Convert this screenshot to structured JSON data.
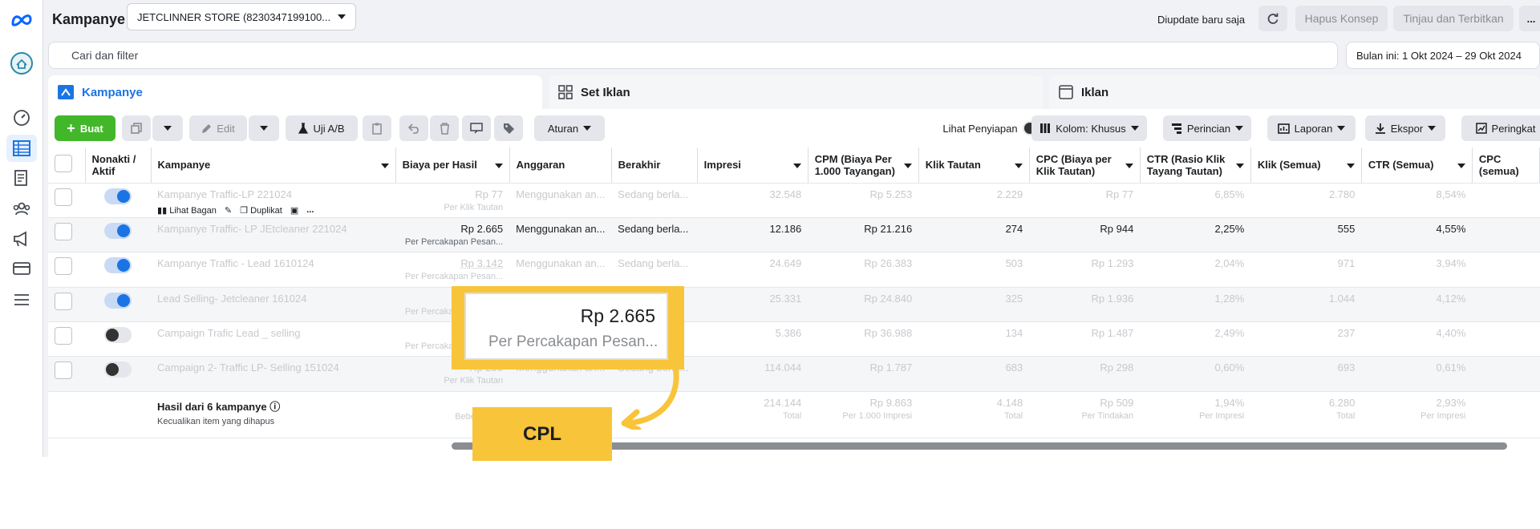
{
  "nav": {
    "items": [
      "meta-logo-icon",
      "business-icon",
      "dashboard-icon",
      "campaigns-icon",
      "pages-icon",
      "audiences-icon",
      "ads-icon",
      "billing-icon",
      "menu-icon"
    ]
  },
  "header": {
    "title": "Kampanye",
    "account": "JETCLINNER STORE (8230347199100...",
    "update_status": "Diupdate baru saja",
    "discard_label": "Hapus Konsep",
    "publish_label": "Tinjau dan Terbitkan",
    "more_label": "..."
  },
  "search": {
    "placeholder": "Cari dan filter"
  },
  "date_range": "Bulan ini: 1 Okt 2024 – 29 Okt 2024",
  "tabs": [
    {
      "label": "Kampanye",
      "icon": "folder-icon"
    },
    {
      "label": "Set Iklan",
      "icon": "grid-icon"
    },
    {
      "label": "Iklan",
      "icon": "ad-frame-icon"
    }
  ],
  "toolbar": {
    "create": "Buat",
    "edit": "Edit",
    "ab_test": "Uji A/B",
    "rules": "Aturan",
    "preview": "Lihat Penyiapan",
    "columns": "Kolom: Khusus",
    "breakdown": "Perincian",
    "reports": "Laporan",
    "export": "Ekspor",
    "summary": "Peringkat"
  },
  "table": {
    "headers": [
      "Nonakti / Aktif",
      "Kampanye",
      "Biaya per Hasil",
      "Anggaran",
      "Berakhir",
      "Impresi",
      "CPM (Biaya Per 1.000 Tayangan)",
      "Klik Tautan",
      "CPC (Biaya per Klik Tautan)",
      "CTR (Rasio Klik Tayang Tautan)",
      "Klik (Semua)",
      "CTR (Semua)",
      "CPC (semua)"
    ],
    "rows": [
      {
        "toggle": true,
        "name": "Kampanye Traffic-LP 221024",
        "cost": "Rp 77",
        "cost_sub": "Per Klik Tautan",
        "budget": "Menggunakan an...",
        "ends": "Sedang berla...",
        "impressions": "32.548",
        "cpm": "Rp 5.253",
        "clicks_link": "2.229",
        "cpc_link": "Rp 77",
        "ctr_link": "6,85%",
        "clicks_all": "2.780",
        "ctr_all": "8,54%"
      },
      {
        "toggle": true,
        "name": "Kampanye Traffic- LP JEtcleaner 221024",
        "cost": "Rp 2.665",
        "cost_sub": "Per Percakapan Pesan...",
        "budget": "Menggunakan an...",
        "ends": "Sedang berla...",
        "impressions": "12.186",
        "cpm": "Rp 21.216",
        "clicks_link": "274",
        "cpc_link": "Rp 944",
        "ctr_link": "2,25%",
        "clicks_all": "555",
        "ctr_all": "4,55%"
      },
      {
        "toggle": true,
        "name": "Kampanye Traffic - Lead 1610124",
        "cost": "Rp 3.142",
        "cost_sub": "Per Percakapan Pesan...",
        "budget": "Menggunakan an...",
        "ends": "Sedang berla...",
        "impressions": "24.649",
        "cpm": "Rp 26.383",
        "clicks_link": "503",
        "cpc_link": "Rp 1.293",
        "ctr_link": "2,04%",
        "clicks_all": "971",
        "ctr_all": "3,94%"
      },
      {
        "toggle": true,
        "name": "Lead Selling- Jetcleaner 161024",
        "cost": "",
        "cost_sub": "Per Percakapan Pesan...",
        "budget": "",
        "ends": "",
        "impressions": "25.331",
        "cpm": "Rp 24.840",
        "clicks_link": "325",
        "cpc_link": "Rp 1.936",
        "ctr_link": "1,28%",
        "clicks_all": "1.044",
        "ctr_all": "4,12%"
      },
      {
        "toggle": false,
        "name": "Campaign Trafic Lead _ selling",
        "cost": "",
        "cost_sub": "Per Percakapan Pesan...",
        "budget": "",
        "ends": "",
        "impressions": "5.386",
        "cpm": "Rp 36.988",
        "clicks_link": "134",
        "cpc_link": "Rp 1.487",
        "ctr_link": "2,49%",
        "clicks_all": "237",
        "ctr_all": "4,40%"
      },
      {
        "toggle": false,
        "name": "Campaign 2- Traffic LP- Selling 151024",
        "cost": "Rp 298",
        "cost_sub": "Per Klik Tautan",
        "budget": "Menggunakan an...",
        "ends": "Sedang berla...",
        "impressions": "114.044",
        "cpm": "Rp 1.787",
        "clicks_link": "683",
        "cpc_link": "Rp 298",
        "ctr_link": "0,60%",
        "clicks_all": "693",
        "ctr_all": "0,61%"
      }
    ],
    "row_actions": {
      "view": "Lihat Bagan",
      "duplicate": "Duplikat",
      "more": "..."
    },
    "summary": {
      "title": "Hasil dari 6 kampanye",
      "subtitle": "Kecualikan item yang dihapus",
      "cost_sub": "Beberapa ...",
      "impressions": "214.144",
      "impressions_sub": "Total",
      "cpm": "Rp 9.863",
      "cpm_sub": "Per 1.000 Impresi",
      "clicks_link": "4.148",
      "clicks_link_sub": "Total",
      "cpc_link": "Rp 509",
      "cpc_link_sub": "Per Tindakan",
      "ctr_link": "1,94%",
      "ctr_link_sub": "Per Impresi",
      "clicks_all": "6.280",
      "clicks_all_sub": "Total",
      "ctr_all": "2,93%",
      "ctr_all_sub": "Per Impresi"
    }
  },
  "callout": {
    "value": "Rp 2.665",
    "sub": "Per Percakapan Pesan...",
    "label": "CPL"
  },
  "colors": {
    "accent": "#1b74e4",
    "create": "#42b72a",
    "highlight": "#f8c43a"
  }
}
